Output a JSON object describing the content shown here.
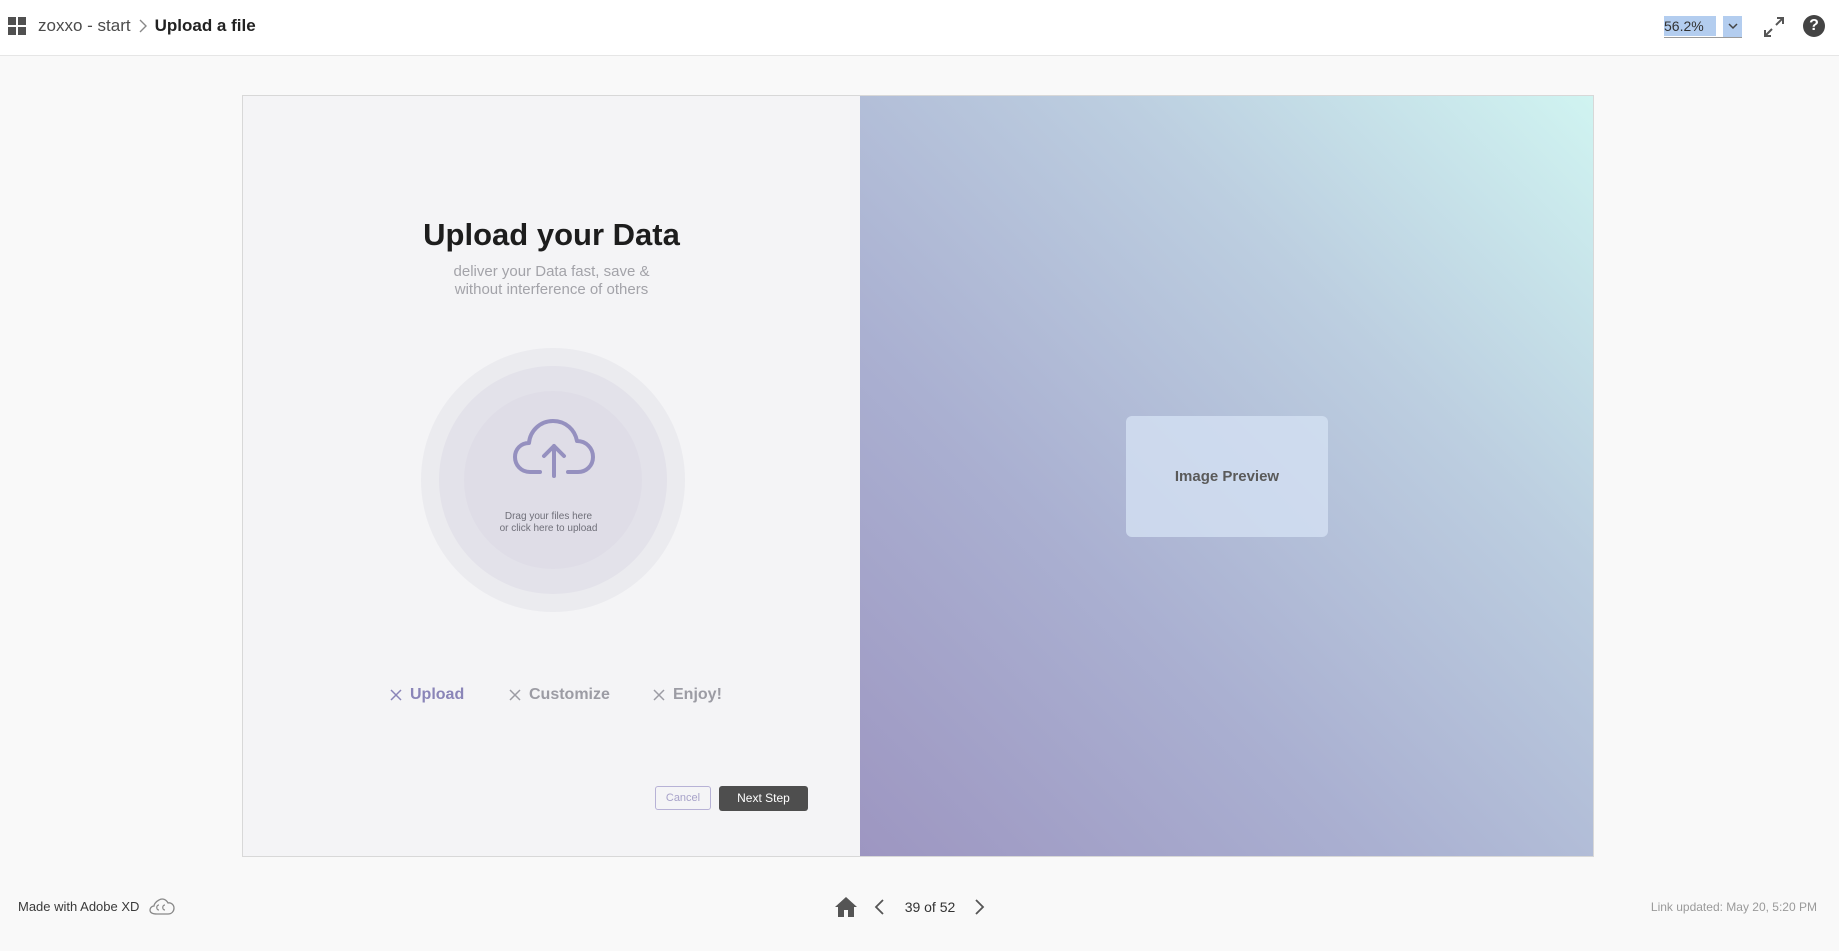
{
  "header": {
    "breadcrumb_parent": "zoxxo - start",
    "breadcrumb_current": "Upload a file",
    "zoom_value": "56.2%",
    "icons": [
      "apps-grid-icon",
      "chevron-right-icon",
      "chevron-down-icon",
      "fullscreen-icon",
      "help-icon"
    ]
  },
  "artboard": {
    "title": "Upload your Data",
    "subtitle_line1": "deliver your Data fast, save &",
    "subtitle_line2": "without interference of others",
    "upload_hint_line1": "Drag your files here",
    "upload_hint_line2": "or click here to upload",
    "steps": [
      {
        "label": "Upload"
      },
      {
        "label": "Customize"
      },
      {
        "label": "Enjoy!"
      }
    ],
    "cancel_label": "Cancel",
    "next_label": "Next Step",
    "preview_label": "Image Preview",
    "colors": {
      "accent": "#8a85b8",
      "dark_button": "#4e4e4e",
      "gradient_start": "#9d96c1",
      "gradient_end": "#d0f4f1"
    }
  },
  "footer": {
    "made_with": "Made with Adobe XD",
    "page_counter": "39 of 52",
    "link_updated": "Link updated: May 20, 5:20 PM",
    "icons": [
      "creative-cloud-icon",
      "home-icon",
      "chevron-left-icon",
      "chevron-right-icon"
    ]
  }
}
